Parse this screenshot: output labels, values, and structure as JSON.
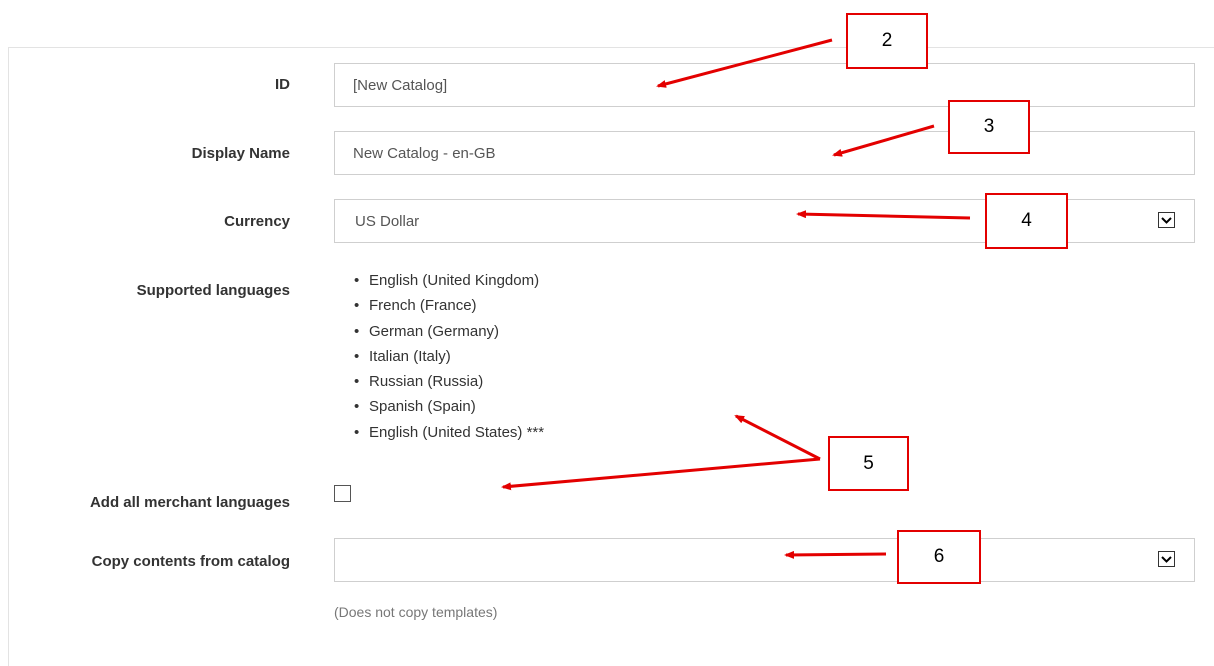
{
  "form": {
    "id": {
      "label": "ID",
      "value": "[New Catalog]"
    },
    "display_name": {
      "label": "Display Name",
      "value": "New Catalog - en-GB"
    },
    "currency": {
      "label": "Currency",
      "value": "US Dollar"
    },
    "supported_languages": {
      "label": "Supported languages",
      "items": [
        "English (United Kingdom)",
        "French (France)",
        "German (Germany)",
        "Italian (Italy)",
        "Russian (Russia)",
        "Spanish (Spain)",
        "English (United States) ***"
      ]
    },
    "add_all_merchant_languages": {
      "label": "Add all merchant languages",
      "checked": false
    },
    "copy_contents": {
      "label": "Copy contents from catalog",
      "value": "",
      "hint": "(Does not copy templates)"
    }
  },
  "annotations": {
    "color": "#e30000",
    "callouts": [
      "2",
      "3",
      "4",
      "5",
      "6"
    ]
  },
  "icons": {
    "dropdown": "chevron-down-icon",
    "checkbox": "checkbox-icon"
  }
}
